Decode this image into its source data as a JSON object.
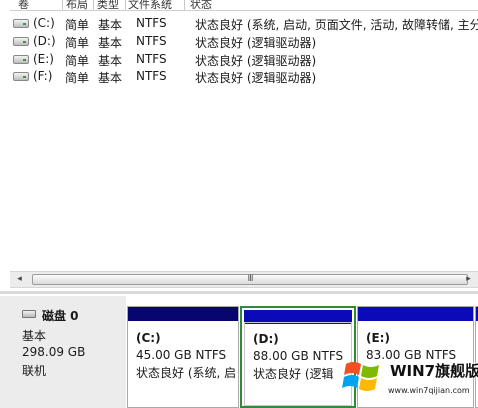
{
  "volume_list": {
    "columns": [
      "卷",
      "布局",
      "类型",
      "文件系统",
      "状态"
    ],
    "rows": [
      {
        "volume": "(C:)",
        "layout": "简单",
        "type": "基本",
        "fs": "NTFS",
        "status": "状态良好 (系统, 启动, 页面文件, 活动, 故障转储, 主分"
      },
      {
        "volume": "(D:)",
        "layout": "简单",
        "type": "基本",
        "fs": "NTFS",
        "status": "状态良好 (逻辑驱动器)"
      },
      {
        "volume": "(E:)",
        "layout": "简单",
        "type": "基本",
        "fs": "NTFS",
        "status": "状态良好 (逻辑驱动器)"
      },
      {
        "volume": "(F:)",
        "layout": "简单",
        "type": "基本",
        "fs": "NTFS",
        "status": "状态良好 (逻辑驱动器)"
      }
    ]
  },
  "scrollbar": {
    "left_arrow": "◂",
    "right_arrow": "▸",
    "grip": "III"
  },
  "disk": {
    "name": "磁盘 0",
    "type": "基本",
    "size": "298.09 GB",
    "state": "联机"
  },
  "partitions": [
    {
      "name": "(C:)",
      "size": "45.00 GB NTFS",
      "status": "状态良好 (系统, 启"
    },
    {
      "name": "(D:)",
      "size": "88.00 GB NTFS",
      "status": "状态良好 (逻辑"
    },
    {
      "name": "(E:)",
      "size": "83.00 GB NTFS",
      "status": ""
    }
  ],
  "watermark": {
    "title": "WIN7旗舰版",
    "url": "www.win7qijian.com"
  },
  "colors": {
    "primary_partition_bar": "#06066e",
    "logical_partition_bar": "#0a0ab8",
    "selection_border": "#2e8b3a"
  }
}
